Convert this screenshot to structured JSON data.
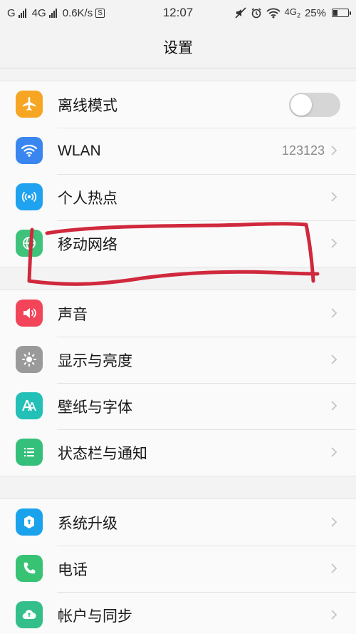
{
  "status_bar": {
    "carrier_1": "G",
    "carrier_2": "4G",
    "speed": "0.6K/s",
    "speed_badge": "S",
    "time": "12:07",
    "network": "4G",
    "network_sub": "2",
    "battery": "25%",
    "battery_level": 0.25
  },
  "header": {
    "title": "设置"
  },
  "groups": [
    {
      "items": [
        {
          "label": "离线模式",
          "icon": "airplane-icon",
          "color": "#f6a623",
          "control": "toggle",
          "toggle_on": false
        },
        {
          "label": "WLAN",
          "icon": "wifi-icon",
          "color": "#3a86f0",
          "value": "123123"
        },
        {
          "label": "个人热点",
          "icon": "hotspot-icon",
          "color": "#1fa2ef"
        },
        {
          "label": "移动网络",
          "icon": "globe-icon",
          "color": "#3fc37a"
        }
      ]
    },
    {
      "items": [
        {
          "label": "声音",
          "icon": "speaker-icon",
          "color": "#f2455a"
        },
        {
          "label": "显示与亮度",
          "icon": "brightness-icon",
          "color": "#9a9a9a"
        },
        {
          "label": "壁纸与字体",
          "icon": "font-icon",
          "color": "#22c0b7"
        },
        {
          "label": "状态栏与通知",
          "icon": "notification-icon",
          "color": "#34c07a"
        }
      ]
    },
    {
      "items": [
        {
          "label": "系统升级",
          "icon": "upgrade-icon",
          "color": "#1aa3ec"
        },
        {
          "label": "电话",
          "icon": "phone-icon",
          "color": "#38c274"
        },
        {
          "label": "帐户与同步",
          "icon": "cloud-sync-icon",
          "color": "#34bf8a"
        }
      ]
    }
  ],
  "annotation": {
    "color": "#d0283c"
  }
}
